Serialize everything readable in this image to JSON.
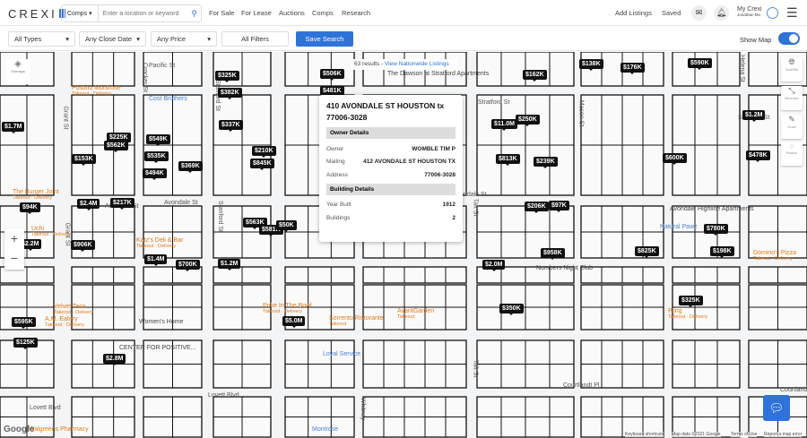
{
  "header": {
    "logo": "CREXI",
    "search_mode": "Comps",
    "search_placeholder": "Enter a location or keyword",
    "nav": [
      "For Sale",
      "For Lease",
      "Auctions",
      "Comps",
      "Research"
    ],
    "right": {
      "add_listings": "Add Listings",
      "saved": "Saved",
      "my_crexi": "My Crexi",
      "user": "Jonathan Mo"
    }
  },
  "filters": {
    "types": "All Types",
    "close_date": "Any Close Date",
    "price": "Any Price",
    "all_filters": "All Filters",
    "save_search": "Save Search",
    "show_map": "Show Map",
    "show_map_on": true
  },
  "map": {
    "results": "63 results",
    "results_sep": " - ",
    "nationwide": "View Nationwide Listings",
    "pins": [
      "$325K",
      "$506K",
      "$481K",
      "$382K",
      "$162K",
      "$138K",
      "$176K",
      "$590K",
      "$1.2M",
      "$478K",
      "$337K",
      "$11.0M",
      "$250K",
      "$1.7M",
      "$225K",
      "$562K",
      "$549K",
      "$153K",
      "$535K",
      "$210K",
      "$845K",
      "$494K",
      "$369K",
      "$813K",
      "$239K",
      "$600K",
      "$94K",
      "$2.4M",
      "$217K",
      "$206K",
      "$97K",
      "$563K",
      "$581K",
      "$50K",
      "$2.2M",
      "$906K",
      "$1.4M",
      "$700K",
      "$1.2M",
      "$780K",
      "$825K",
      "$958K",
      "$198K",
      "$2.0M",
      "$350K",
      "$325K",
      "$5.0M",
      "$595K",
      "$125K",
      "$2.8M"
    ],
    "streets": [
      "Pacific St",
      "Stratford St",
      "Stratford St",
      "Avondale St",
      "Avondale St",
      "Avondale St",
      "Lovett Blvd",
      "Lovett Blvd",
      "Courtlandt Pl",
      "Courtlandt Pl",
      "Grant St",
      "Grant St",
      "Crocker St",
      "Stanford St",
      "Stanford St",
      "Taft St",
      "Taft St",
      "Mason St",
      "Helena St",
      "Whitney"
    ],
    "pois": [
      {
        "name": "Postino Montrose",
        "sub": "Takeout · Delivery"
      },
      {
        "name": "Cost Brothers",
        "sub": ""
      },
      {
        "name": "The Burger Joint",
        "sub": "Takeout · Delivery"
      },
      {
        "name": "Uchi",
        "sub": "Takeout · Delivery"
      },
      {
        "name": "Katz's Deli & Bar",
        "sub": "Takeout · Delivery"
      },
      {
        "name": "Velvet Taco",
        "sub": "Takeout · Delivery"
      },
      {
        "name": "A.M. Eatery",
        "sub": "Takeout · Delivery"
      },
      {
        "name": "Women's Home",
        "sub": ""
      },
      {
        "name": "CENTER FOR POSITIVE...",
        "sub": ""
      },
      {
        "name": "Poke In The Bowl",
        "sub": "Takeout · Delivery"
      },
      {
        "name": "Sorrento Ristorante",
        "sub": "Takeout"
      },
      {
        "name": "AvantGarden",
        "sub": "Takeout"
      },
      {
        "name": "Loyal Service",
        "sub": ""
      },
      {
        "name": "Numbers Night Club",
        "sub": ""
      },
      {
        "name": "Avondale Highline Apartments",
        "sub": ""
      },
      {
        "name": "Natural Pawz",
        "sub": ""
      },
      {
        "name": "Domino's Pizza",
        "sub": "Takeout · Delivery"
      },
      {
        "name": "Pling",
        "sub": "Takeout · Delivery"
      },
      {
        "name": "Walgreens Pharmacy",
        "sub": ""
      },
      {
        "name": "Montrose",
        "sub": ""
      },
      {
        "name": "The Dawson at Stratford Apartments",
        "sub": ""
      }
    ],
    "controls": [
      "Satellite",
      "Minimize",
      "Draw",
      "Radius"
    ],
    "overlays": "Overlays",
    "footer": [
      "Keyboard shortcuts",
      "Map data ©2021 Google",
      "Terms of Use",
      "Report a map error"
    ],
    "google": "Google"
  },
  "popup": {
    "title": "410 AVONDALE ST HOUSTON tx 77006-3028",
    "owner_section": "Owner Details",
    "owner_rows": [
      {
        "label": "Owner",
        "value": "WOMBLE TIM P"
      },
      {
        "label": "Mailing",
        "value": "412 AVONDALE ST HOUSTON TX"
      },
      {
        "label": "Address",
        "value": "77006-3028"
      }
    ],
    "building_section": "Building Details",
    "building_rows": [
      {
        "label": "Year Built",
        "value": "1912"
      },
      {
        "label": "Buildings",
        "value": "2"
      }
    ]
  }
}
